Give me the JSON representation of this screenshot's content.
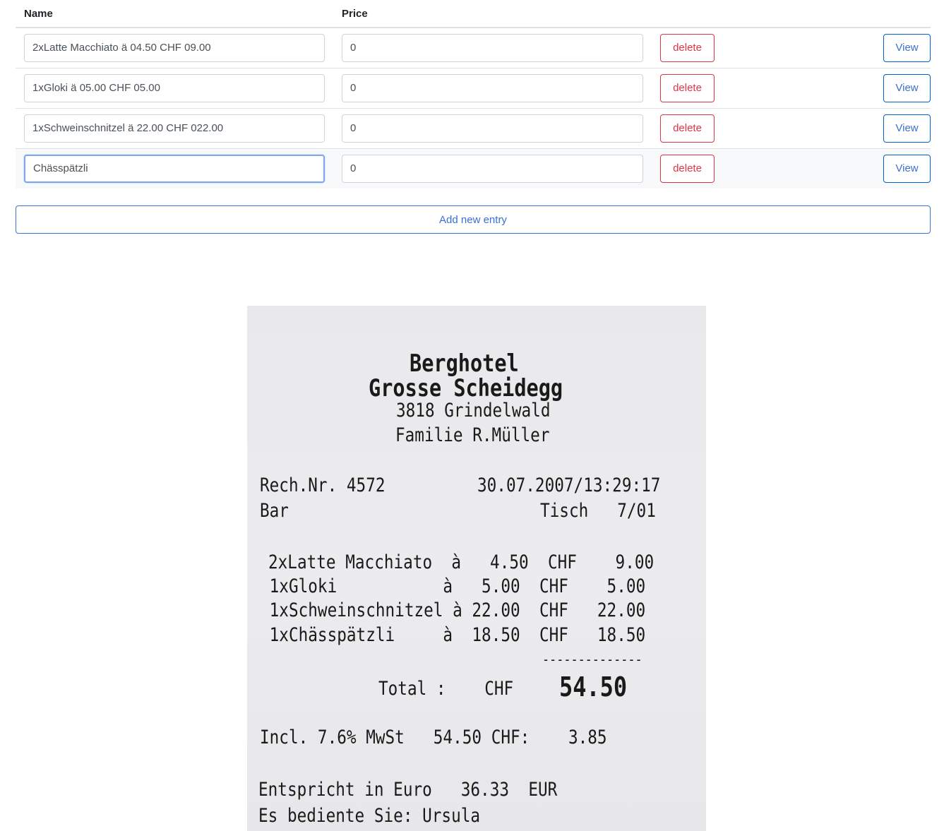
{
  "table": {
    "headers": {
      "name": "Name",
      "price": "Price"
    },
    "rows": [
      {
        "name": "2xLatte Macchiato ä 04.50 CHF 09.00",
        "price": "0",
        "delete_label": "delete",
        "view_label": "View"
      },
      {
        "name": "1xGloki ä 05.00 CHF 05.00",
        "price": "0",
        "delete_label": "delete",
        "view_label": "View"
      },
      {
        "name": "1xSchweinschnitzel ä 22.00 CHF 022.00",
        "price": "0",
        "delete_label": "delete",
        "view_label": "View"
      },
      {
        "name": "Chässpätzli",
        "price": "0",
        "delete_label": "delete",
        "view_label": "View"
      }
    ]
  },
  "add_entry_label": "Add new entry",
  "receipt": {
    "hotel_line1": "Berghotel",
    "hotel_line2": "Grosse Scheidegg",
    "address": "3818 Grindelwald",
    "family": "Familie R.Müller",
    "invoice_no": "Rech.Nr. 4572",
    "datetime": "30.07.2007/13:29:17",
    "location": "Bar",
    "table_label": "Tisch   7/01",
    "items": [
      "2xLatte Macchiato  à   4.50  CHF    9.00",
      " 1xGloki           à   5.00  CHF    5.00",
      " 1xSchweinschnitzel à 22.00  CHF   22.00",
      " 1xChässpätzli     à  18.50  CHF   18.50"
    ],
    "separator": "--------------",
    "total_label": "Total :    CHF",
    "total_value": "54.50",
    "vat_line": "Incl. 7.6% MwSt   54.50 CHF:    3.85",
    "euro_line": "Entspricht in Euro   36.33  EUR",
    "served_line": "Es bediente Sie: Ursula"
  },
  "colors": {
    "delete": "#dc3545",
    "primary": "#3b6fd1",
    "focus": "#80a8e8"
  }
}
